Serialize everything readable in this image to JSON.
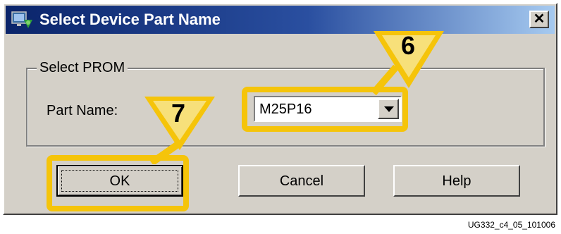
{
  "window": {
    "title": "Select Device Part Name",
    "close_label": "✕"
  },
  "group": {
    "label": "Select PROM",
    "part_name_label": "Part Name:",
    "part_name_value": "M25P16"
  },
  "buttons": {
    "ok": "OK",
    "cancel": "Cancel",
    "help": "Help"
  },
  "callouts": {
    "step_6": "6",
    "step_7": "7"
  },
  "caption": "UG332_c4_05_101006",
  "colors": {
    "highlight": "#f5c40a",
    "titlebar_start": "#0a246a",
    "titlebar_end": "#a6caf0",
    "dialog_bg": "#d4d0c8"
  }
}
